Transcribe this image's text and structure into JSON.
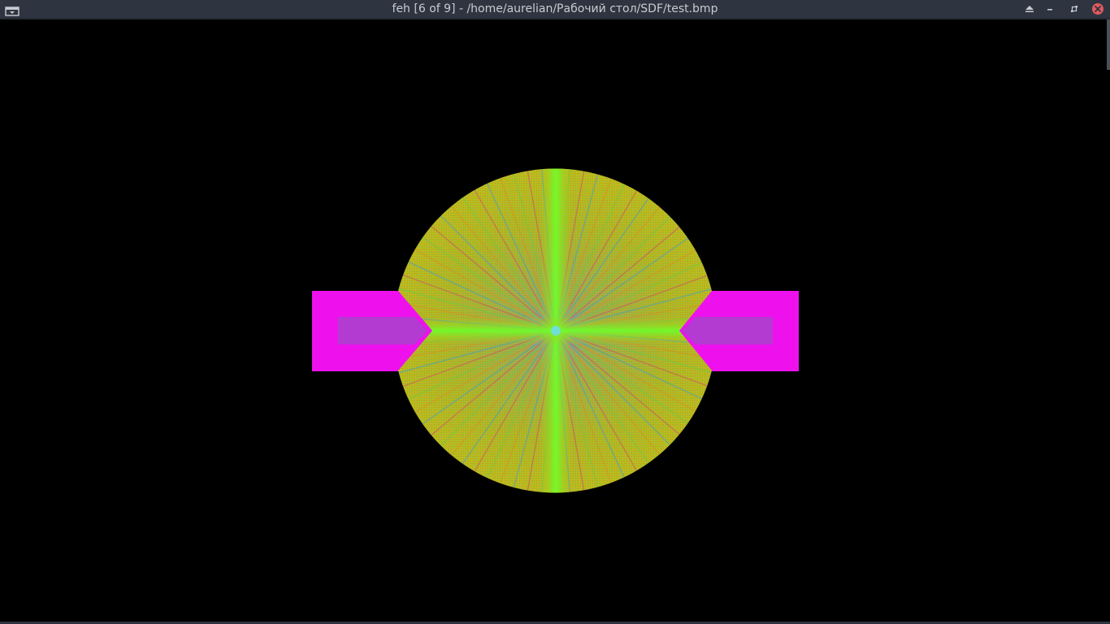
{
  "window": {
    "title": "feh [6 of 9] - /home/aurelian/Рабочий стол/SDF/test.bmp",
    "app_menu_icon": "window-menu-icon",
    "buttons": {
      "keep_above_icon": "eject-up-icon",
      "minimize_icon": "minimize-icon",
      "maximize_icon": "restore-icon",
      "close_icon": "close-icon"
    }
  },
  "image": {
    "description_icon": "sdf-render-image",
    "colors": {
      "magenta": "#ee11ee",
      "inner_purple": "#b33bd1",
      "yellow_green": "#b5c716",
      "bright_green": "#6dff2a",
      "cyan": "#3ed7d9",
      "background": "#000000"
    }
  }
}
